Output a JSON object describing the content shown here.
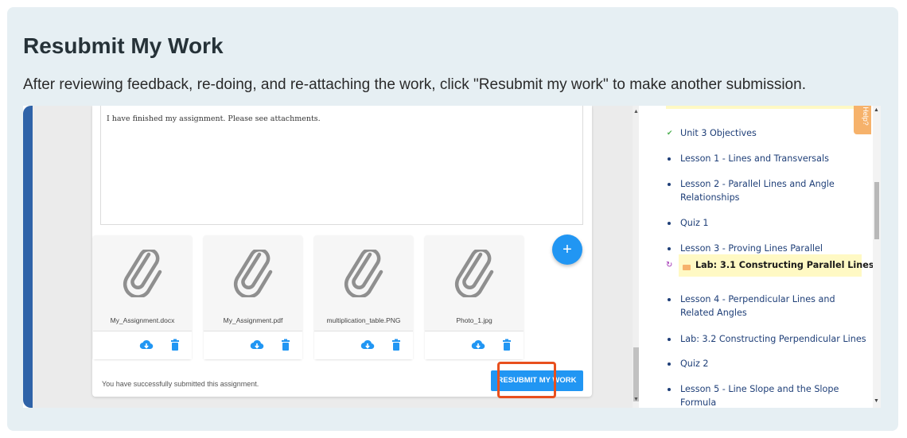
{
  "section": {
    "title": "Resubmit My Work",
    "intro": "After reviewing feedback, re-doing, and re-attaching the work, click \"Resubmit my work\" to make another submission."
  },
  "submission": {
    "comment_text": "I have finished my assignment. Please see attachments.",
    "attachments": [
      {
        "filename": "My_Assignment.docx"
      },
      {
        "filename": "My_Assignment.pdf"
      },
      {
        "filename": "multiplication_table.PNG"
      },
      {
        "filename": "Photo_1.jpg"
      }
    ],
    "add_button": "+",
    "success_message": "You have successfully submitted this assignment.",
    "resubmit_label": "RESUBMIT MY WORK"
  },
  "sidebar": {
    "help_tab": "Help?",
    "items": [
      {
        "label": "Unit 3 Objectives",
        "status": "check"
      },
      {
        "label": "Lesson 1 - Lines and Transversals"
      },
      {
        "label": "Lesson 2 - Parallel Lines and Angle Relationships"
      },
      {
        "label": "Quiz 1"
      },
      {
        "label": "Lesson 3 - Proving Lines Parallel"
      },
      {
        "label": "Lab: 3.1 Constructing Parallel Lines",
        "current": true
      },
      {
        "label": "Lesson 4 - Perpendicular Lines and Related Angles"
      },
      {
        "label": "Lab: 3.2 Constructing Perpendicular Lines"
      },
      {
        "label": "Quiz 2"
      },
      {
        "label": "Lesson 5 - Line Slope and the Slope Formula"
      }
    ]
  },
  "colors": {
    "accent": "#2196f3",
    "highlight_border": "#e8501e",
    "current_item_bg": "#fff9c4",
    "link": "#1f3f78"
  }
}
